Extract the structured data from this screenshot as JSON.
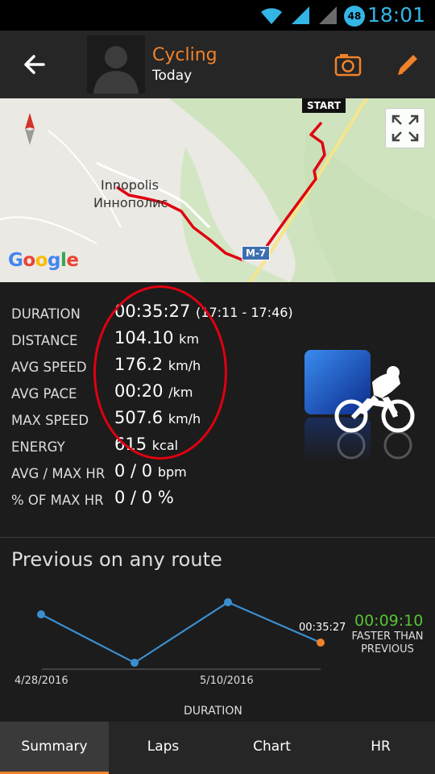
{
  "status_bar": {
    "time": "18:01",
    "battery": "48"
  },
  "header": {
    "title": "Cycling",
    "subtitle": "Today"
  },
  "map": {
    "city_latin": "Innopolis",
    "city_cyrillic": "Иннополис",
    "start_label": "START",
    "road_label": "M-7",
    "logo": "Google"
  },
  "stats": [
    {
      "label": "DURATION",
      "value": "00:35:27",
      "unit": "",
      "extra": "(17:11 - 17:46)"
    },
    {
      "label": "DISTANCE",
      "value": "104.10",
      "unit": "km",
      "extra": ""
    },
    {
      "label": "AVG SPEED",
      "value": "176.2",
      "unit": "km/h",
      "extra": ""
    },
    {
      "label": "AVG PACE",
      "value": "00:20",
      "unit": "/km",
      "extra": ""
    },
    {
      "label": "MAX SPEED",
      "value": "507.6",
      "unit": "km/h",
      "extra": ""
    },
    {
      "label": "ENERGY",
      "value": "615",
      "unit": "kcal",
      "extra": ""
    },
    {
      "label": "AVG / MAX HR",
      "value": "0 / 0",
      "unit": "bpm",
      "extra": ""
    },
    {
      "label": "% OF MAX HR",
      "value": "0 / 0 %",
      "unit": "",
      "extra": ""
    }
  ],
  "previous": {
    "title": "Previous on any route",
    "faster_value": "00:09:10",
    "faster_text": "FASTER THAN PREVIOUS",
    "current_label": "00:35:27",
    "date_labels": [
      "4/28/2016",
      "5/10/2016"
    ],
    "axis_title": "DURATION"
  },
  "tabs": [
    {
      "label": "Summary",
      "active": true
    },
    {
      "label": "Laps",
      "active": false
    },
    {
      "label": "Chart",
      "active": false
    },
    {
      "label": "HR",
      "active": false
    }
  ],
  "colors": {
    "accent": "#f0822a",
    "line": "#3a8fd0",
    "faster": "#57c235",
    "highlight_oval": "#e00010"
  }
}
